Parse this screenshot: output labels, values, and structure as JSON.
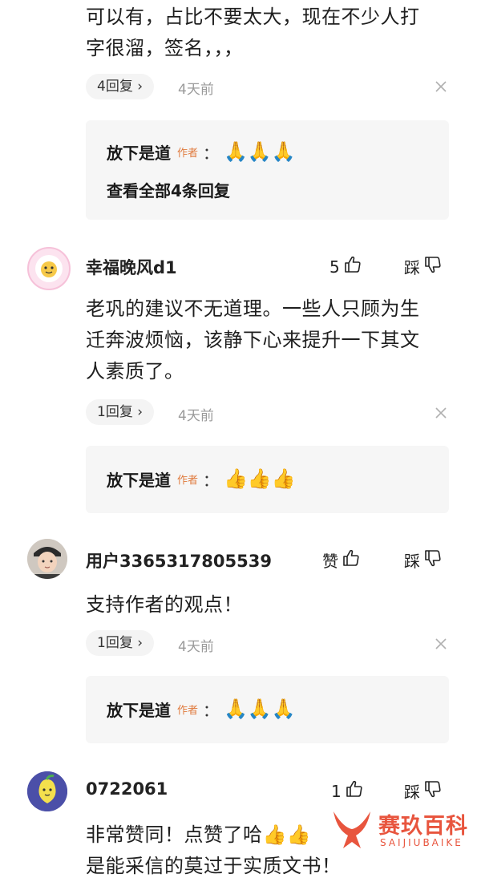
{
  "top_comment": {
    "text_line1": "可以有，占比不要太大，现在不少人打",
    "text_line2": "字很溜，签名，，，",
    "reply_count": "4回复",
    "time": "4天前",
    "reply": {
      "author": "放下是道",
      "author_tag": "作者",
      "colon": "：",
      "emoji": "🙏🙏🙏",
      "view_all": "查看全部4条回复"
    }
  },
  "comments": [
    {
      "user": "幸福晚风d1",
      "like": "5",
      "dislike": "踩",
      "text": [
        "老巩的建议不无道理。一些人只顾为生",
        "迁奔波烦恼，该静下心来提升一下其文",
        "人素质了。"
      ],
      "reply_count": "1回复",
      "time": "4天前",
      "reply": {
        "author": "放下是道",
        "author_tag": "作者",
        "colon": "：",
        "emoji": "👍👍👍"
      }
    },
    {
      "user": "用户3365317805539",
      "like": "赞",
      "dislike": "踩",
      "text": [
        "支持作者的观点！"
      ],
      "reply_count": "1回复",
      "time": "4天前",
      "reply": {
        "author": "放下是道",
        "author_tag": "作者",
        "colon": "：",
        "emoji": "🙏🙏🙏"
      }
    },
    {
      "user": "0722061",
      "like": "1",
      "dislike": "踩",
      "text": [
        "非常赞同！点赞了哈👍👍",
        "是能采信的莫过于实质文书！"
      ]
    }
  ],
  "watermark": {
    "cn": "赛玖百科",
    "en": "SAIJIUBAIKE"
  },
  "colors": {
    "author_tag": "#e07a3d",
    "watermark": "#e8553e",
    "reply_bg": "#f6f6f6"
  }
}
